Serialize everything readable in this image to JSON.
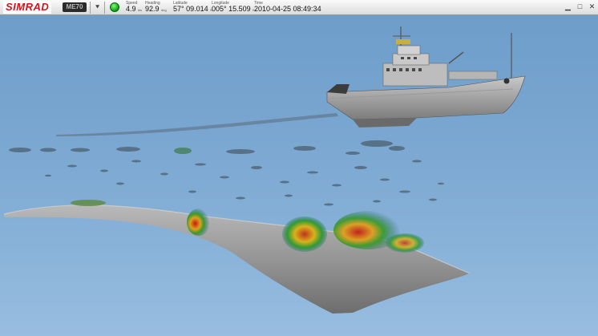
{
  "brand": "SIMRAD",
  "model": "ME70",
  "status": {
    "speed": {
      "label": "Speed",
      "value": "4.9",
      "unit": "kts"
    },
    "heading": {
      "label": "Heading",
      "value": "92.9",
      "unit": "deg"
    },
    "latitude": {
      "label": "Latitude",
      "value": "57° 09.014",
      "unit": "N"
    },
    "longitude": {
      "label": "Longitude",
      "value": "005° 15.509",
      "unit": "E"
    },
    "time": {
      "label": "Time",
      "value": "2010-04-25 08:49:34"
    }
  },
  "icons": {
    "menu": "chevron-double-down-icon",
    "status": "status-led-icon",
    "minimize": "minimize-icon",
    "maximize": "maximize-icon",
    "close": "close-icon"
  },
  "colors": {
    "brand_red": "#d0141c",
    "sky": "#6f9ec9",
    "status_led": "#18c018"
  }
}
